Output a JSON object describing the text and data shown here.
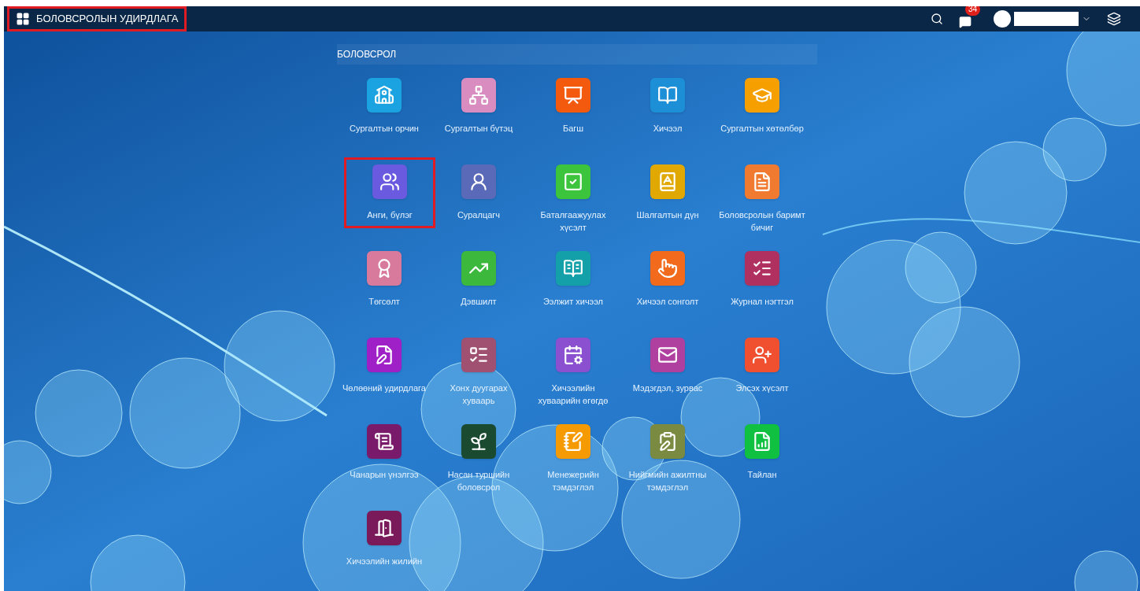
{
  "top_bar": {
    "title": "БОЛОВСРОЛЫН УДИРДЛАГА",
    "title_highlighted": true,
    "notifications_badge": "34"
  },
  "section": {
    "title": "БОЛОВСРОЛ"
  },
  "apps": [
    {
      "label": "Сургалтын орчин",
      "color": "#1aa3e0",
      "highlighted": false
    },
    {
      "label": "Сургалтын бүтэц",
      "color": "#d98cbf",
      "highlighted": false
    },
    {
      "label": "Багш",
      "color": "#f45a0e",
      "highlighted": false
    },
    {
      "label": "Хичээл",
      "color": "#1d8fd6",
      "highlighted": false
    },
    {
      "label": "Сургалтын хөтөлбөр",
      "color": "#f5a000",
      "highlighted": false
    },
    {
      "label": "Анги, бүлэг",
      "color": "#6a5ae0",
      "highlighted": true
    },
    {
      "label": "Суралцагч",
      "color": "#5a6ab8",
      "highlighted": false
    },
    {
      "label": "Баталгаажуулах хүсэлт",
      "color": "#3cc43c",
      "highlighted": false
    },
    {
      "label": "Шалгалтын дүн",
      "color": "#e0a800",
      "highlighted": false
    },
    {
      "label": "Боловсролын баримт бичиг",
      "color": "#f07a30",
      "highlighted": false
    },
    {
      "label": "Төгсөлт",
      "color": "#d77a9c",
      "highlighted": false
    },
    {
      "label": "Дэвшилт",
      "color": "#3cb83c",
      "highlighted": false
    },
    {
      "label": "Ээлжит хичээл",
      "color": "#14a0a8",
      "highlighted": false
    },
    {
      "label": "Хичээл сонголт",
      "color": "#f26a1b",
      "highlighted": false
    },
    {
      "label": "Журнал нэгтгэл",
      "color": "#b03060",
      "highlighted": false
    },
    {
      "label": "Чөлөөний удирдлага",
      "color": "#a020c8",
      "highlighted": false
    },
    {
      "label": "Хонх дуугарах хуваарь",
      "color": "#a05070",
      "highlighted": false
    },
    {
      "label": "Хичээлийн хуваарийн өгөгдө",
      "color": "#8a50d0",
      "highlighted": false
    },
    {
      "label": "Мэдэгдэл, зурвас",
      "color": "#b040a0",
      "highlighted": false
    },
    {
      "label": "Элсэх хүсэлт",
      "color": "#f05030",
      "highlighted": false
    },
    {
      "label": "Чанарын үнэлгээ",
      "color": "#7a1a6a",
      "highlighted": false
    },
    {
      "label": "Насан туршийн боловсрол",
      "color": "#1a4a30",
      "highlighted": false
    },
    {
      "label": "Менежерийн тэмдэглэл",
      "color": "#f59a00",
      "highlighted": false
    },
    {
      "label": "Нийгмийн ажилтны тэмдэглэл",
      "color": "#7a8a40",
      "highlighted": false
    },
    {
      "label": "Тайлан",
      "color": "#10c040",
      "highlighted": false
    },
    {
      "label": "Хичээлийн жилийн",
      "color": "#7a1a5a",
      "highlighted": false
    }
  ]
}
